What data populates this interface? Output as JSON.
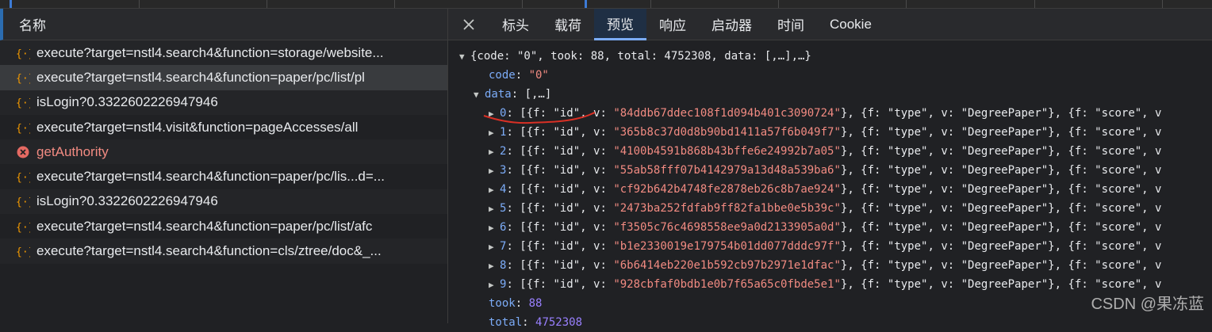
{
  "left_panel": {
    "header": "名称",
    "requests": [
      {
        "name": "execute?target=nstl4.search4&function=storage/website...",
        "type": "xhr",
        "selected": false
      },
      {
        "name": "execute?target=nstl4.search4&function=paper/pc/list/pl",
        "type": "xhr",
        "selected": true
      },
      {
        "name": "isLogin?0.3322602226947946",
        "type": "xhr",
        "selected": false
      },
      {
        "name": "execute?target=nstl4.visit&function=pageAccesses/all",
        "type": "xhr",
        "selected": false
      },
      {
        "name": "getAuthority",
        "type": "error",
        "selected": false
      },
      {
        "name": "execute?target=nstl4.search4&function=paper/pc/lis...d=...",
        "type": "xhr",
        "selected": false
      },
      {
        "name": "isLogin?0.3322602226947946",
        "type": "xhr",
        "selected": false
      },
      {
        "name": "execute?target=nstl4.search4&function=paper/pc/list/afc",
        "type": "xhr",
        "selected": false
      },
      {
        "name": "execute?target=nstl4.search4&function=cls/ztree/doc&_...",
        "type": "xhr",
        "selected": false
      }
    ]
  },
  "tabs": {
    "close_icon": "close-icon",
    "items": [
      "标头",
      "载荷",
      "预览",
      "响应",
      "启动器",
      "时间",
      "Cookie"
    ],
    "active": "预览"
  },
  "preview": {
    "root_summary": "{code: \"0\", took: 88, total: 4752308, data: [,…],…}",
    "code_key": "code",
    "code_value": "\"0\"",
    "data_key": "data",
    "data_summary": "[,…]",
    "rows": [
      {
        "index": "0",
        "id": "\"84ddb67ddec108f1d094b401c3090724\""
      },
      {
        "index": "1",
        "id": "\"365b8c37d0d8b90bd1411a57f6b049f7\""
      },
      {
        "index": "2",
        "id": "\"4100b4591b868b43bffe6e24992b7a05\""
      },
      {
        "index": "3",
        "id": "\"55ab58fff07b4142979a13d48a539ba6\""
      },
      {
        "index": "4",
        "id": "\"cf92b642b4748fe2878eb26c8b7ae924\""
      },
      {
        "index": "5",
        "id": "\"2473ba252fdfab9ff82fa1bbe0e5b39c\""
      },
      {
        "index": "6",
        "id": "\"f3505c76c4698558ee9a0d2133905a0d\""
      },
      {
        "index": "7",
        "id": "\"b1e2330019e179754b01dd077dddc97f\""
      },
      {
        "index": "8",
        "id": "\"6b6414eb220e1b592cb97b2971e1dfac\""
      },
      {
        "index": "9",
        "id": "\"928cbfaf0bdb1e0b7f65a65c0fbde5e1\""
      }
    ],
    "row_prefix": "[{f: \"id\", v: ",
    "row_middle": "}, {f: \"type\", v: \"DegreePaper\"}, {f: \"score\", v",
    "took_key": "took",
    "took_value": "88",
    "total_key": "total",
    "total_value": "4752308"
  },
  "watermark": "CSDN @果冻蓝",
  "colors": {
    "accent": "#7cacf8",
    "string": "#f28b82",
    "number": "#9980ff",
    "error": "#f28b82",
    "xhr_icon": "#f29900"
  }
}
